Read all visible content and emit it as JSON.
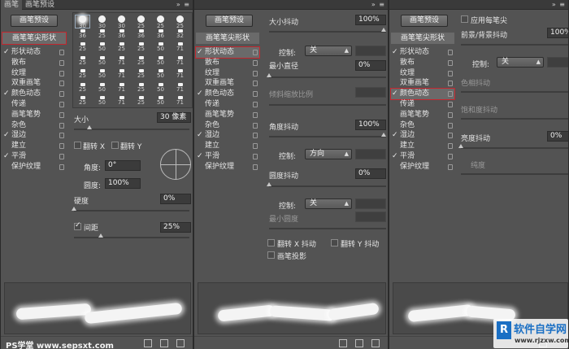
{
  "panel1": {
    "tabs": [
      "画笔",
      "画笔预设"
    ],
    "preset_button": "画笔预设",
    "sidebar_header": "画笔笔尖形状",
    "sidebar": [
      {
        "label": "形状动态",
        "checked": true
      },
      {
        "label": "散布",
        "checked": false
      },
      {
        "label": "纹理",
        "checked": false
      },
      {
        "label": "双重画笔",
        "checked": false
      },
      {
        "label": "颜色动态",
        "checked": true
      },
      {
        "label": "传递",
        "checked": false
      },
      {
        "label": "画笔笔势",
        "checked": false
      },
      {
        "label": "杂色",
        "checked": false
      },
      {
        "label": "湿边",
        "checked": true
      },
      {
        "label": "建立",
        "checked": false
      },
      {
        "label": "平滑",
        "checked": true
      },
      {
        "label": "保护纹理",
        "checked": false
      }
    ],
    "brush_sizes": [
      [
        "30",
        "30",
        "30",
        "25",
        "25",
        "25"
      ],
      [
        "36",
        "25",
        "36",
        "36",
        "36",
        "32"
      ],
      [
        "25",
        "50",
        "25",
        "25",
        "50",
        "71"
      ],
      [
        "25",
        "50",
        "71",
        "25",
        "50",
        "71"
      ],
      [
        "25",
        "50",
        "71",
        "25",
        "50",
        "71"
      ],
      [
        "25",
        "50",
        "71",
        "25",
        "50",
        "71"
      ],
      [
        "25",
        "50",
        "71",
        "25",
        "50",
        "71"
      ]
    ],
    "size_label": "大小",
    "size_value": "30 像素",
    "flip_x": "翻转 X",
    "flip_y": "翻转 Y",
    "angle_label": "角度:",
    "angle_value": "0°",
    "roundness_label": "圆度:",
    "roundness_value": "100%",
    "hardness_label": "硬度",
    "hardness_value": "0%",
    "hardness_level": 0,
    "size_level": 0.12,
    "spacing_label": "间距",
    "spacing_value": "25%",
    "spacing_level": 0.25,
    "watermark": "PS学堂 www.sepsxt.com"
  },
  "panel2": {
    "preset_button": "画笔预设",
    "sidebar_header": "画笔笔尖形状",
    "sidebar": [
      {
        "label": "形状动态",
        "checked": true,
        "highlight": true
      },
      {
        "label": "散布",
        "checked": false
      },
      {
        "label": "纹理",
        "checked": false
      },
      {
        "label": "双重画笔",
        "checked": false
      },
      {
        "label": "颜色动态",
        "checked": true
      },
      {
        "label": "传递",
        "checked": false
      },
      {
        "label": "画笔笔势",
        "checked": false
      },
      {
        "label": "杂色",
        "checked": false
      },
      {
        "label": "湿边",
        "checked": true
      },
      {
        "label": "建立",
        "checked": false
      },
      {
        "label": "平滑",
        "checked": true
      },
      {
        "label": "保护纹理",
        "checked": false
      }
    ],
    "size_jitter_label": "大小抖动",
    "size_jitter_value": "100%",
    "control_label": "控制:",
    "control1_value": "关",
    "min_diameter_label": "最小直径",
    "min_diameter_value": "0%",
    "tilt_scale_label": "倾斜缩放比例",
    "angle_jitter_label": "角度抖动",
    "angle_jitter_value": "100%",
    "control2_value": "方向",
    "roundness_jitter_label": "圆度抖动",
    "roundness_jitter_value": "0%",
    "control3_value": "关",
    "min_roundness_label": "最小圆度",
    "flip_x_jitter": "翻转 X 抖动",
    "flip_y_jitter": "翻转 Y 抖动",
    "brush_projection": "画笔投影"
  },
  "panel3": {
    "preset_button": "画笔预设",
    "sidebar_header": "画笔笔尖形状",
    "sidebar": [
      {
        "label": "形状动态",
        "checked": true
      },
      {
        "label": "散布",
        "checked": false
      },
      {
        "label": "纹理",
        "checked": false
      },
      {
        "label": "双重画笔",
        "checked": false
      },
      {
        "label": "颜色动态",
        "checked": true,
        "highlight": true
      },
      {
        "label": "传递",
        "checked": false
      },
      {
        "label": "画笔笔势",
        "checked": false
      },
      {
        "label": "杂色",
        "checked": false
      },
      {
        "label": "湿边",
        "checked": true
      },
      {
        "label": "建立",
        "checked": false
      },
      {
        "label": "平滑",
        "checked": true
      },
      {
        "label": "保护纹理",
        "checked": false
      }
    ],
    "apply_per_tip": "应用每笔尖",
    "fg_bg_jitter_label": "前景/背景抖动",
    "fg_bg_jitter_value": "100%",
    "control_label": "控制:",
    "control_value": "关",
    "hue_jitter_label": "色相抖动",
    "saturation_jitter_label": "饱和度抖动",
    "brightness_jitter_label": "亮度抖动",
    "brightness_jitter_value": "0%",
    "purity_label": "纯度",
    "watermark": "软件自学网",
    "watermark_url": "www.rjzxw.com"
  },
  "colors": {
    "highlight": "#c3262e",
    "panel": "#535353"
  }
}
